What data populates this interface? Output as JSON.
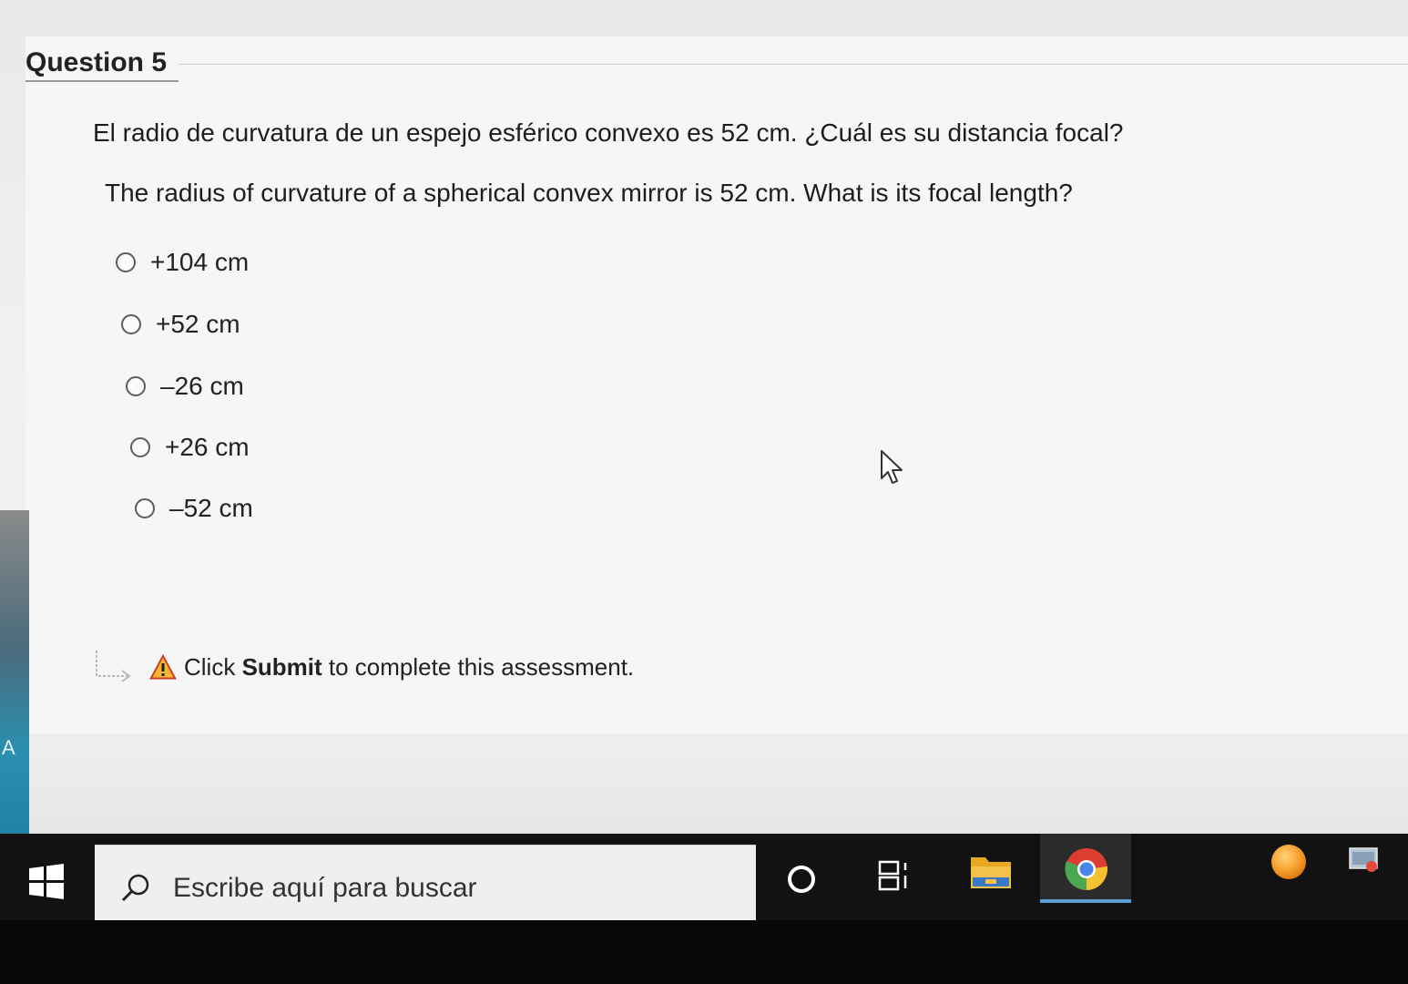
{
  "question": {
    "title": "Question 5",
    "text_es": "El radio de curvatura de un espejo esférico convexo es 52 cm. ¿Cuál es su distancia focal?",
    "text_en": "The radius of curvature of a spherical convex mirror is 52 cm.  What is its focal length?",
    "options": [
      {
        "label": "+104 cm",
        "selected": false
      },
      {
        "label": "+52 cm",
        "selected": false
      },
      {
        "label": "–26 cm",
        "selected": false
      },
      {
        "label": "+26 cm",
        "selected": false
      },
      {
        "label": "–52 cm",
        "selected": false
      }
    ]
  },
  "submit_notice": {
    "prefix": "Click ",
    "bold": "Submit",
    "suffix": " to complete this assessment."
  },
  "left_edge_text": "A",
  "taskbar": {
    "search_placeholder": "Escribe aquí para buscar",
    "icons": [
      "windows-start-icon",
      "search-icon",
      "cortana-icon",
      "task-view-icon",
      "file-explorer-icon",
      "chrome-icon",
      "orange-app-icon",
      "photos-app-icon"
    ]
  },
  "colors": {
    "panel_bg": "#f6f6f6",
    "taskbar_bg": "#121212",
    "chrome_active": "#5aa0d6",
    "warning": "#e0442b"
  }
}
